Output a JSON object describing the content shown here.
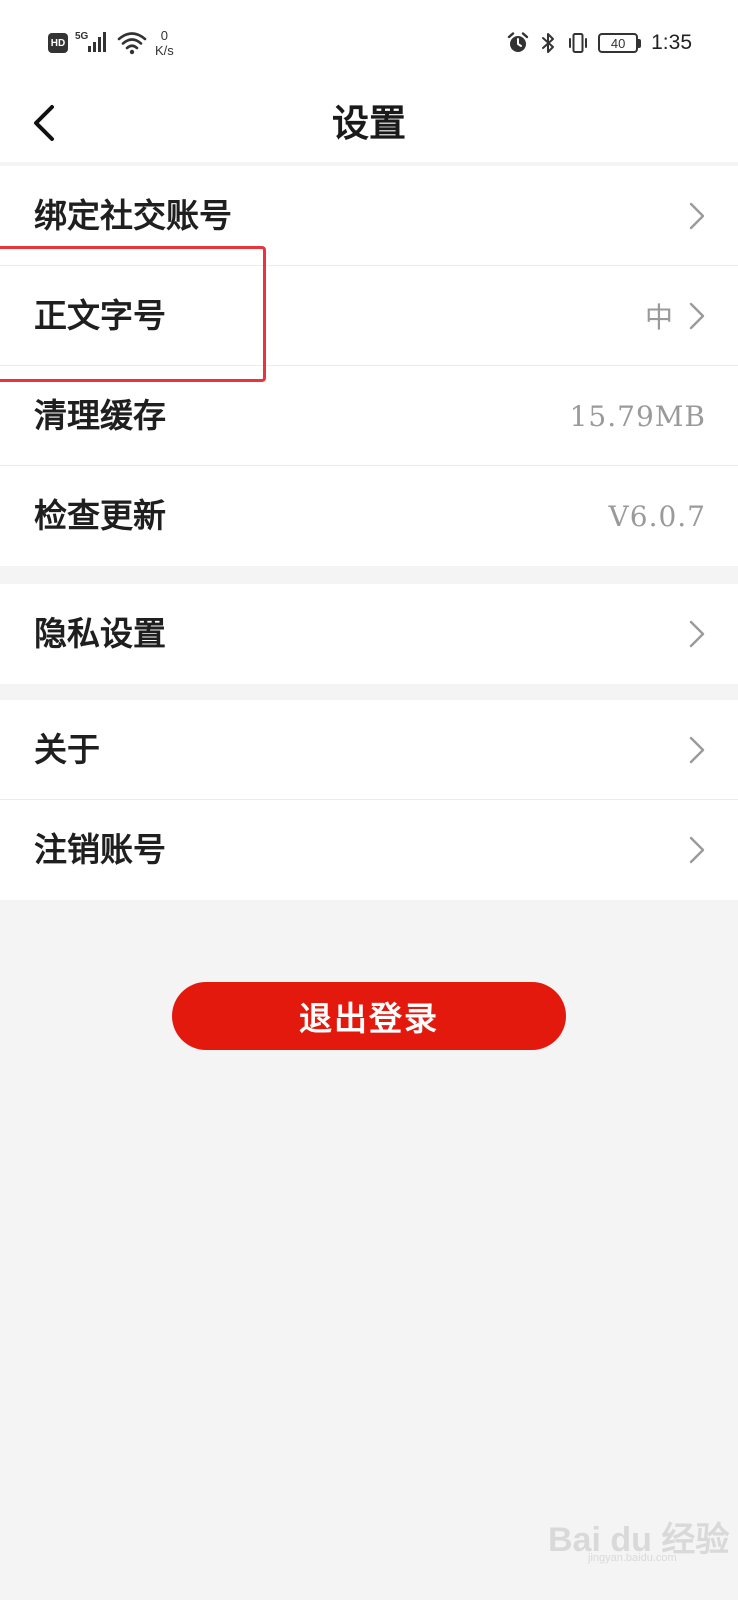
{
  "status_bar": {
    "hd_label": "HD",
    "network_label": "5G",
    "speed_value": "0",
    "speed_unit": "K/s",
    "battery_level": "40",
    "time": "1:35",
    "icons": [
      "hd-icon",
      "signal-icon",
      "wifi-icon",
      "alarm-icon",
      "bluetooth-icon",
      "vibrate-icon",
      "battery-icon"
    ]
  },
  "header": {
    "title": "设置",
    "back_icon": "back-arrow-icon"
  },
  "groups": [
    {
      "items": [
        {
          "label": "绑定社交账号",
          "value": "",
          "has_chevron": true
        },
        {
          "label": "正文字号",
          "value": "中",
          "has_chevron": true
        },
        {
          "label": "清理缓存",
          "value": "15.79MB",
          "has_chevron": false
        },
        {
          "label": "检查更新",
          "value": "V6.0.7",
          "has_chevron": false
        }
      ]
    },
    {
      "items": [
        {
          "label": "隐私设置",
          "value": "",
          "has_chevron": true
        }
      ]
    },
    {
      "items": [
        {
          "label": "关于",
          "value": "",
          "has_chevron": true
        },
        {
          "label": "注销账号",
          "value": "",
          "has_chevron": true
        }
      ]
    }
  ],
  "logout": {
    "label": "退出登录"
  },
  "watermark": {
    "main": "Bai du 经验",
    "sub": "jingyan.baidu.com"
  },
  "colors": {
    "accent": "#e3190e",
    "highlight": "#e8343a",
    "background": "#f4f4f4",
    "value_text": "#9a9a9a"
  }
}
